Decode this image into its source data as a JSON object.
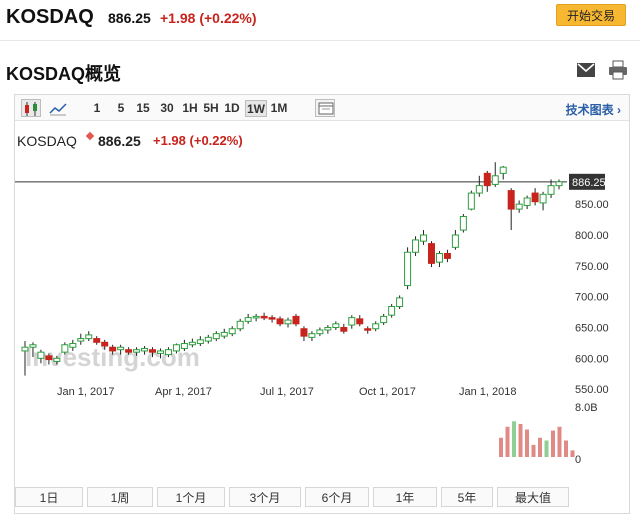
{
  "header": {
    "symbol": "KOSDAQ",
    "price": "886.25",
    "change": "+1.98 (+0.22%)",
    "trade_button": "开始交易"
  },
  "overview": {
    "title": "KOSDAQ概览",
    "icons": [
      "mail-icon",
      "print-icon"
    ]
  },
  "toolbar": {
    "timeframes": [
      "1",
      "5",
      "15",
      "30",
      "1H",
      "5H",
      "1D",
      "1W",
      "1M"
    ],
    "active_timeframe": "1W",
    "technical_chart": "技术图表"
  },
  "chart_header": {
    "symbol": "KOSDAQ",
    "price": "886.25",
    "change": "+1.98",
    "change_pct": "(+0.22%)"
  },
  "watermark": {
    "logo": "Investing.com"
  },
  "chart_data": {
    "type": "candlestick",
    "price_axis": {
      "ticks": [
        850,
        800,
        750,
        700,
        650,
        600,
        550
      ],
      "labels": [
        "850.00",
        "800.00",
        "750.00",
        "700.00",
        "650.00",
        "600.00",
        "550.00"
      ],
      "range": [
        520,
        1000
      ]
    },
    "last_price_label": "886.25",
    "last_price": 886.25,
    "x_tick_labels": [
      "Jan 1, 2017",
      "Apr 1, 2017",
      "Jul 1, 2017",
      "Oct 1, 2017",
      "Jan 1, 2018"
    ],
    "volume_axis": {
      "labels": [
        "8.0B",
        "0"
      ],
      "range": [
        0,
        8
      ]
    },
    "candles": [
      {
        "o": 612,
        "c": 618,
        "h": 628,
        "l": 572
      },
      {
        "o": 618,
        "c": 622,
        "h": 626,
        "l": 602
      },
      {
        "o": 600,
        "c": 610,
        "h": 614,
        "l": 592
      },
      {
        "o": 604,
        "c": 598,
        "h": 608,
        "l": 590
      },
      {
        "o": 595,
        "c": 600,
        "h": 604,
        "l": 590
      },
      {
        "o": 610,
        "c": 622,
        "h": 626,
        "l": 606
      },
      {
        "o": 618,
        "c": 624,
        "h": 630,
        "l": 612
      },
      {
        "o": 628,
        "c": 632,
        "h": 640,
        "l": 622
      },
      {
        "o": 632,
        "c": 638,
        "h": 644,
        "l": 628
      },
      {
        "o": 632,
        "c": 626,
        "h": 636,
        "l": 622
      },
      {
        "o": 626,
        "c": 620,
        "h": 630,
        "l": 614
      },
      {
        "o": 618,
        "c": 612,
        "h": 622,
        "l": 606
      },
      {
        "o": 614,
        "c": 618,
        "h": 622,
        "l": 606
      },
      {
        "o": 614,
        "c": 610,
        "h": 618,
        "l": 606
      },
      {
        "o": 610,
        "c": 614,
        "h": 618,
        "l": 604
      },
      {
        "o": 612,
        "c": 616,
        "h": 620,
        "l": 606
      },
      {
        "o": 614,
        "c": 610,
        "h": 618,
        "l": 602
      },
      {
        "o": 608,
        "c": 612,
        "h": 616,
        "l": 600
      },
      {
        "o": 606,
        "c": 614,
        "h": 618,
        "l": 602
      },
      {
        "o": 612,
        "c": 622,
        "h": 624,
        "l": 608
      },
      {
        "o": 616,
        "c": 624,
        "h": 630,
        "l": 612
      },
      {
        "o": 622,
        "c": 626,
        "h": 632,
        "l": 618
      },
      {
        "o": 624,
        "c": 630,
        "h": 636,
        "l": 620
      },
      {
        "o": 628,
        "c": 634,
        "h": 638,
        "l": 624
      },
      {
        "o": 632,
        "c": 640,
        "h": 644,
        "l": 628
      },
      {
        "o": 636,
        "c": 642,
        "h": 648,
        "l": 632
      },
      {
        "o": 640,
        "c": 648,
        "h": 652,
        "l": 636
      },
      {
        "o": 648,
        "c": 660,
        "h": 664,
        "l": 644
      },
      {
        "o": 660,
        "c": 666,
        "h": 672,
        "l": 656
      },
      {
        "o": 666,
        "c": 668,
        "h": 672,
        "l": 660
      },
      {
        "o": 668,
        "c": 666,
        "h": 674,
        "l": 662
      },
      {
        "o": 666,
        "c": 664,
        "h": 670,
        "l": 658
      },
      {
        "o": 664,
        "c": 656,
        "h": 668,
        "l": 652
      },
      {
        "o": 656,
        "c": 662,
        "h": 666,
        "l": 650
      },
      {
        "o": 668,
        "c": 656,
        "h": 672,
        "l": 652
      },
      {
        "o": 648,
        "c": 636,
        "h": 652,
        "l": 628
      },
      {
        "o": 634,
        "c": 640,
        "h": 644,
        "l": 628
      },
      {
        "o": 640,
        "c": 646,
        "h": 650,
        "l": 636
      },
      {
        "o": 646,
        "c": 650,
        "h": 654,
        "l": 640
      },
      {
        "o": 650,
        "c": 656,
        "h": 660,
        "l": 646
      },
      {
        "o": 650,
        "c": 644,
        "h": 656,
        "l": 640
      },
      {
        "o": 654,
        "c": 666,
        "h": 670,
        "l": 648
      },
      {
        "o": 664,
        "c": 656,
        "h": 670,
        "l": 652
      },
      {
        "o": 648,
        "c": 646,
        "h": 652,
        "l": 640
      },
      {
        "o": 648,
        "c": 656,
        "h": 660,
        "l": 644
      },
      {
        "o": 658,
        "c": 668,
        "h": 672,
        "l": 654
      },
      {
        "o": 670,
        "c": 684,
        "h": 688,
        "l": 666
      },
      {
        "o": 684,
        "c": 698,
        "h": 702,
        "l": 680
      },
      {
        "o": 718,
        "c": 772,
        "h": 780,
        "l": 712
      },
      {
        "o": 772,
        "c": 792,
        "h": 798,
        "l": 766
      },
      {
        "o": 790,
        "c": 800,
        "h": 808,
        "l": 784
      },
      {
        "o": 786,
        "c": 754,
        "h": 790,
        "l": 748
      },
      {
        "o": 756,
        "c": 770,
        "h": 774,
        "l": 748
      },
      {
        "o": 770,
        "c": 762,
        "h": 776,
        "l": 756
      },
      {
        "o": 780,
        "c": 800,
        "h": 808,
        "l": 776
      },
      {
        "o": 808,
        "c": 830,
        "h": 834,
        "l": 804
      },
      {
        "o": 842,
        "c": 868,
        "h": 872,
        "l": 840
      },
      {
        "o": 868,
        "c": 880,
        "h": 896,
        "l": 862
      },
      {
        "o": 900,
        "c": 880,
        "h": 904,
        "l": 870
      },
      {
        "o": 882,
        "c": 896,
        "h": 918,
        "l": 878
      },
      {
        "o": 900,
        "c": 910,
        "h": 912,
        "l": 890
      },
      {
        "o": 872,
        "c": 842,
        "h": 876,
        "l": 808
      },
      {
        "o": 842,
        "c": 850,
        "h": 856,
        "l": 836
      },
      {
        "o": 848,
        "c": 860,
        "h": 864,
        "l": 842
      },
      {
        "o": 868,
        "c": 854,
        "h": 876,
        "l": 848
      },
      {
        "o": 852,
        "c": 866,
        "h": 870,
        "l": 840
      },
      {
        "o": 866,
        "c": 880,
        "h": 890,
        "l": 860
      },
      {
        "o": 880,
        "c": 886.25,
        "h": 890,
        "l": 874
      }
    ],
    "volume": [
      {
        "v": 3.5,
        "up": false
      },
      {
        "v": 5.5,
        "up": false
      },
      {
        "v": 6.5,
        "up": true
      },
      {
        "v": 6.0,
        "up": false
      },
      {
        "v": 5.0,
        "up": false
      },
      {
        "v": 2.2,
        "up": false
      },
      {
        "v": 3.5,
        "up": false
      },
      {
        "v": 3.0,
        "up": true
      },
      {
        "v": 4.8,
        "up": false
      },
      {
        "v": 5.5,
        "up": false
      },
      {
        "v": 3.0,
        "up": false
      },
      {
        "v": 1.2,
        "up": false
      }
    ]
  },
  "ranges": [
    "1日",
    "1周",
    "1个月",
    "3个月",
    "6个月",
    "1年",
    "5年",
    "最大值"
  ]
}
